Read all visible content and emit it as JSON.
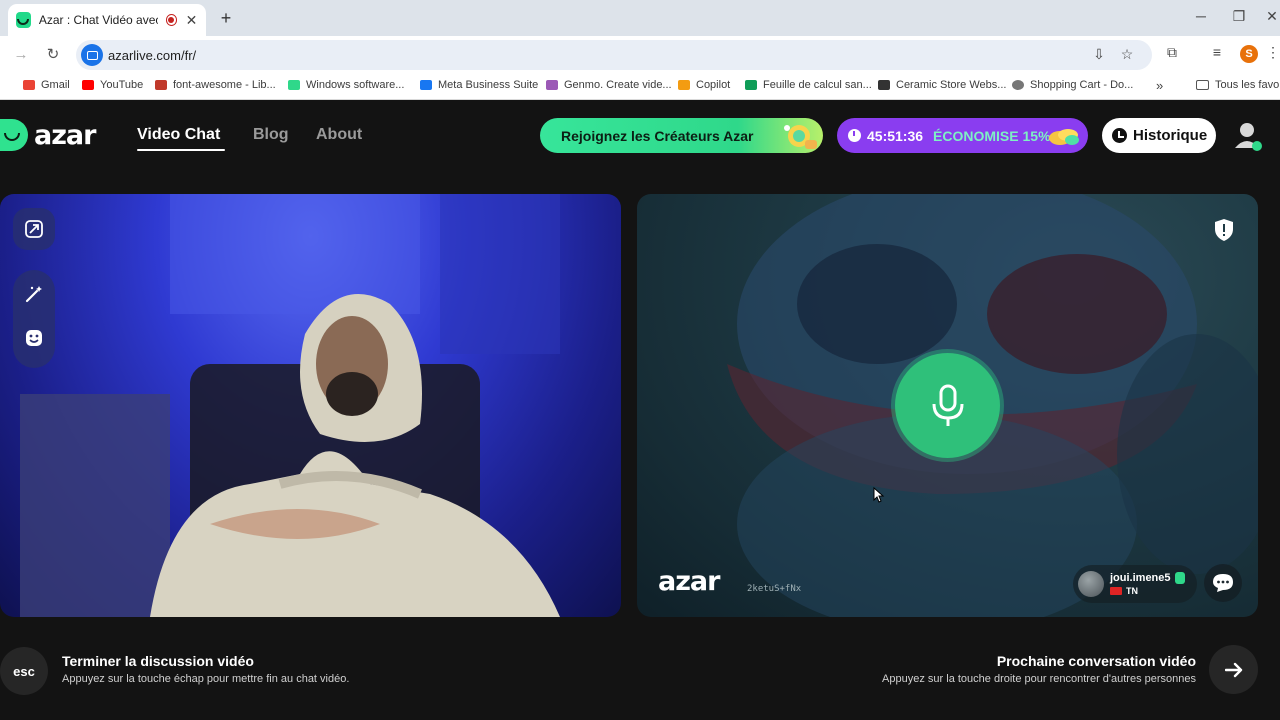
{
  "browser": {
    "tab_title": "Azar : Chat Vidéo avec de n",
    "new_tab": "+",
    "url": "azarlive.com/fr/",
    "profile_initial": "S"
  },
  "bookmarks": {
    "items": [
      {
        "label": "Gmail",
        "color": "#ea4335"
      },
      {
        "label": "YouTube",
        "color": "#ff0000"
      },
      {
        "label": "font-awesome - Lib...",
        "color": "#c0392b"
      },
      {
        "label": "Windows software...",
        "color": "#2fd88a"
      },
      {
        "label": "Meta Business Suite",
        "color": "#1877f2"
      },
      {
        "label": "Genmo. Create vide...",
        "color": "#9b59b6"
      },
      {
        "label": "Copilot",
        "color": "#f39c12"
      },
      {
        "label": "Feuille de calcul san...",
        "color": "#0f9d58"
      },
      {
        "label": "Ceramic Store Webs...",
        "color": "#333333"
      },
      {
        "label": "Shopping Cart - Do...",
        "color": "#777777"
      }
    ],
    "more": "»",
    "folder": "Tous les favor"
  },
  "header": {
    "logo": "azar",
    "nav": {
      "video_chat": "Video Chat",
      "blog": "Blog",
      "about": "About"
    },
    "creators_cta": "Rejoignez les Créateurs Azar",
    "promo_time": "45:51:36",
    "promo_save": "ÉCONOMISE 15%",
    "history": "Historique"
  },
  "remote": {
    "watermark": "azar",
    "watermark_id": "2ketuS+fNx",
    "username": "joui.imene5",
    "country": "TN"
  },
  "actions": {
    "esc_key": "esc",
    "end_title": "Terminer la discussion vidéo",
    "end_sub": "Appuyez sur la touche échap pour mettre fin au chat vidéo.",
    "next_title": "Prochaine conversation vidéo",
    "next_sub": "Appuyez sur la touche droite pour rencontrer d'autres personnes"
  },
  "colors": {
    "brand": "#2fe28f",
    "promo": "#8a3df0",
    "mic": "#2fc07a"
  }
}
